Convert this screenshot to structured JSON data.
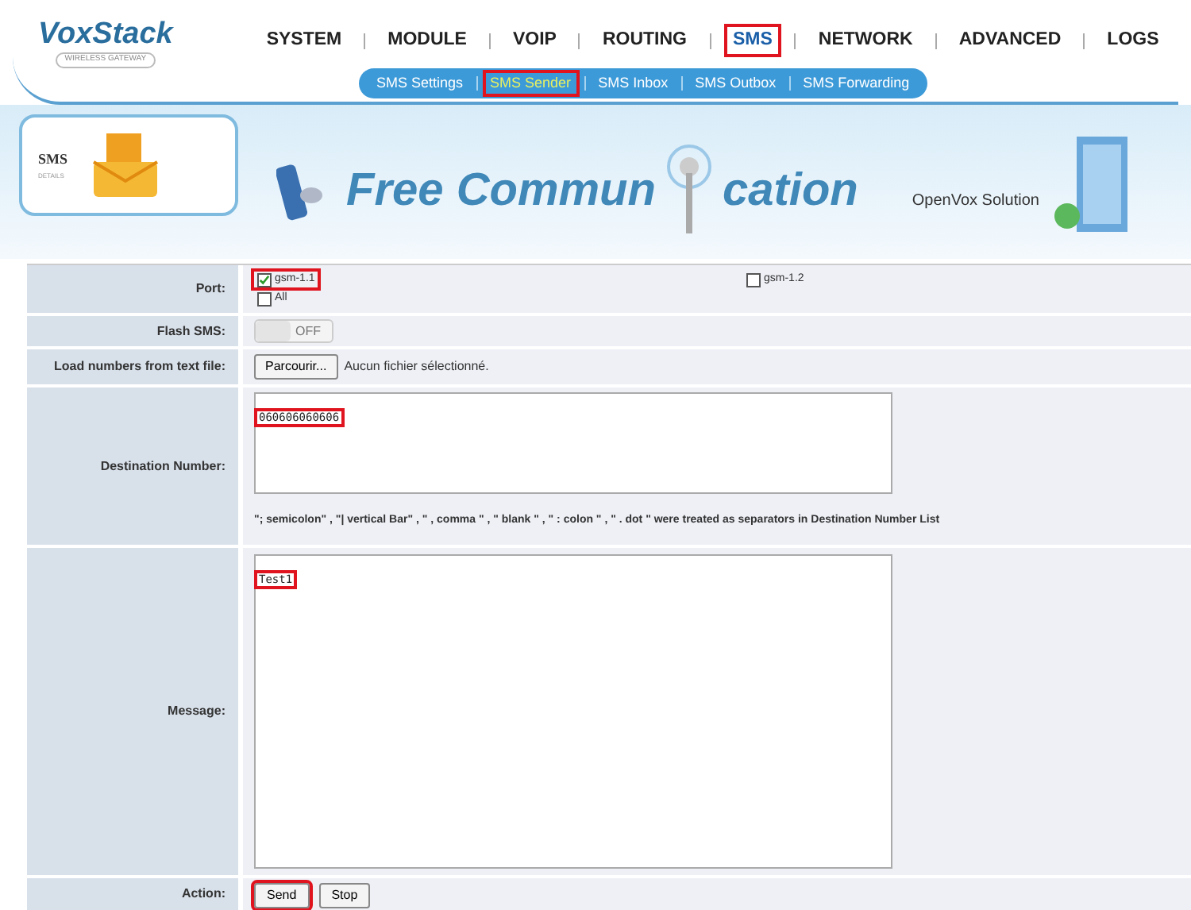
{
  "logo": {
    "name": "VoxStack",
    "tagline": "WIRELESS GATEWAY"
  },
  "nav": [
    {
      "label": "SYSTEM",
      "selected": false,
      "highlighted": false
    },
    {
      "label": "MODULE",
      "selected": false,
      "highlighted": false
    },
    {
      "label": "VOIP",
      "selected": false,
      "highlighted": false
    },
    {
      "label": "ROUTING",
      "selected": false,
      "highlighted": false
    },
    {
      "label": "SMS",
      "selected": true,
      "highlighted": true
    },
    {
      "label": "NETWORK",
      "selected": false,
      "highlighted": false
    },
    {
      "label": "ADVANCED",
      "selected": false,
      "highlighted": false
    },
    {
      "label": "LOGS",
      "selected": false,
      "highlighted": false
    }
  ],
  "subnav": [
    {
      "label": "SMS Settings",
      "selected": false,
      "highlighted": false
    },
    {
      "label": "SMS Sender",
      "selected": true,
      "highlighted": true
    },
    {
      "label": "SMS Inbox",
      "selected": false,
      "highlighted": false
    },
    {
      "label": "SMS Outbox",
      "selected": false,
      "highlighted": false
    },
    {
      "label": "SMS Forwarding",
      "selected": false,
      "highlighted": false
    }
  ],
  "banner": {
    "section": "SMS",
    "section_sub": "DETAILS",
    "slogan_start": "Free Commun",
    "slogan_end": "cation",
    "company": "OpenVox Solution"
  },
  "form": {
    "port": {
      "label": "Port:",
      "options": [
        {
          "label": "gsm-1.1",
          "checked": true,
          "highlighted": true
        },
        {
          "label": "gsm-1.2",
          "checked": false,
          "highlighted": false
        }
      ],
      "all": {
        "label": "All",
        "checked": false
      }
    },
    "flash": {
      "label": "Flash SMS:",
      "on": false,
      "text": "OFF"
    },
    "file": {
      "label": "Load numbers from text file:",
      "button": "Parcourir...",
      "status": "Aucun fichier sélectionné."
    },
    "destination": {
      "label": "Destination Number:",
      "value": "060606060606",
      "highlighted": true,
      "note": "\"; semicolon\" , \"| vertical Bar\" , \" , comma \" , \" blank \" , \" : colon \" , \" . dot \" were treated as separators in Destination Number List"
    },
    "message": {
      "label": "Message:",
      "value": "Test1",
      "highlighted": true
    },
    "action": {
      "label": "Action:",
      "buttons": [
        {
          "label": "Send",
          "highlighted": true
        },
        {
          "label": "Stop",
          "highlighted": false
        }
      ]
    }
  }
}
